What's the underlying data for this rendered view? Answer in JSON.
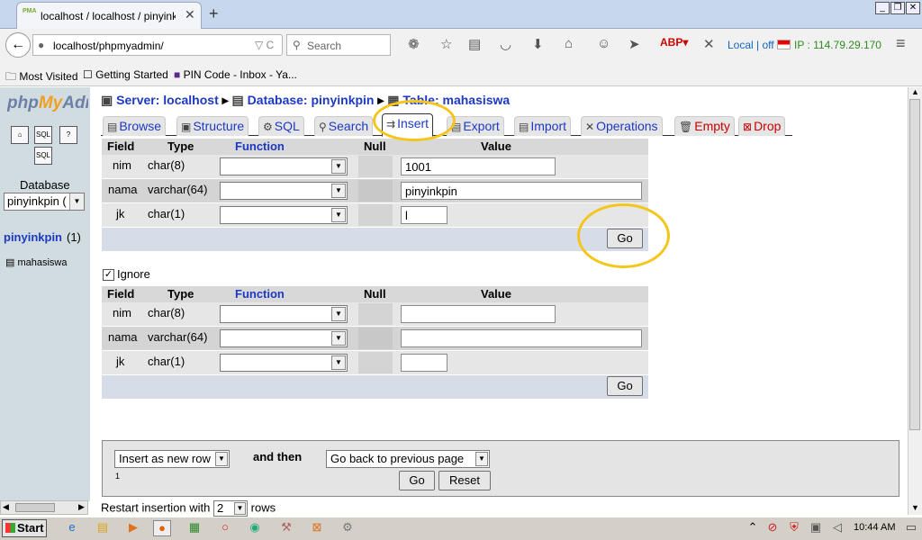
{
  "browser": {
    "tab_title": "localhost / localhost / pinyinkp...",
    "tab_icon": "PMA",
    "url": "localhost/phpmyadmin/",
    "search_placeholder": "Search",
    "local_status": "Local | off",
    "ip_label": "IP : 114.79.29.170"
  },
  "bookmarks": {
    "most_visited": "Most Visited",
    "getting_started": "Getting Started",
    "pin_code": "PIN Code - Inbox - Ya..."
  },
  "sidebar": {
    "logo": "phpMyAdmin",
    "database_label": "Database",
    "database_selected": "pinyinkpin (",
    "db_link": "pinyinkpin",
    "db_count": "(1)",
    "table": "mahasiswa"
  },
  "breadcrumb": {
    "server": "Server: localhost",
    "database": "Database: pinyinkpin",
    "table": "Table: mahasiswa"
  },
  "tabs": [
    {
      "label": "Browse"
    },
    {
      "label": "Structure"
    },
    {
      "label": "SQL"
    },
    {
      "label": "Search"
    },
    {
      "label": "Insert"
    },
    {
      "label": "Export"
    },
    {
      "label": "Import"
    },
    {
      "label": "Operations"
    },
    {
      "label": "Empty"
    },
    {
      "label": "Drop"
    }
  ],
  "table_headers": {
    "field": "Field",
    "type": "Type",
    "function": "Function",
    "null": "Null",
    "value": "Value"
  },
  "form1": {
    "rows": [
      {
        "field": "nim",
        "type": "char(8)",
        "value": "1001"
      },
      {
        "field": "nama",
        "type": "varchar(64)",
        "value": "pinyinkpin"
      },
      {
        "field": "jk",
        "type": "char(1)",
        "value": "l"
      }
    ],
    "go": "Go"
  },
  "ignore_label": "Ignore",
  "form2": {
    "rows": [
      {
        "field": "nim",
        "type": "char(8)",
        "value": ""
      },
      {
        "field": "nama",
        "type": "varchar(64)",
        "value": ""
      },
      {
        "field": "jk",
        "type": "char(1)",
        "value": ""
      }
    ],
    "go": "Go"
  },
  "bottom": {
    "insert_mode": "Insert as new row",
    "and_then": "and then",
    "after_action": "Go back to previous page",
    "footnote": "1",
    "go": "Go",
    "reset": "Reset",
    "restart_label": "Restart insertion with",
    "restart_count": "2",
    "rows_label": "rows"
  },
  "taskbar": {
    "start": "Start",
    "clock": "10:44 AM"
  },
  "colors": {
    "link": "#1d39c4",
    "highlight_circle": "#f5c518",
    "sidebar_bg": "#d0dce0"
  }
}
